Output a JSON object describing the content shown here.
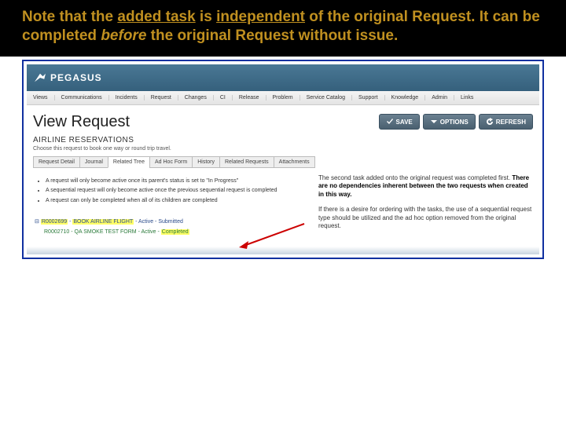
{
  "note": {
    "pre": "Note that the ",
    "added_task": "added task",
    "mid1": " is ",
    "independent": "independent",
    "mid2": " of the original Request. It can be completed ",
    "before": "before",
    "post": " the original Request without issue."
  },
  "app": {
    "brand": "PEGASUS",
    "menu": [
      "Views",
      "Communications",
      "Incidents",
      "Request",
      "Changes",
      "CI",
      "Release",
      "Problem",
      "Service Catalog",
      "Support",
      "Knowledge",
      "Admin",
      "Links"
    ]
  },
  "page": {
    "title": "View Request",
    "buttons": {
      "save": "SAVE",
      "options": "OPTIONS",
      "refresh": "REFRESH"
    },
    "section": {
      "title": "AIRLINE RESERVATIONS",
      "subtitle": "Choose this request to book one way or round trip travel."
    },
    "tabs": [
      "Request Detail",
      "Journal",
      "Related Tree",
      "Ad Hoc Form",
      "History",
      "Related Requests",
      "Attachments"
    ],
    "activeTabIndex": 2
  },
  "bullets": [
    "A request will only become active once its parent's status is set to \"In Progress\"",
    "A sequential request will only become active once the previous sequential request is completed",
    "A request can only be completed when all of its children are completed"
  ],
  "tasks": {
    "row1": {
      "prefix": "⊟ ",
      "id": "R0002699",
      "sep": " - ",
      "name": "BOOK AIRLINE FLIGHT",
      "status1": " - Active - ",
      "status2": "Submitted"
    },
    "row2": {
      "id": "R0002710",
      "sep": " - ",
      "name": "QA SMOKE TEST FORM",
      "status1": " - Active - ",
      "status2": "Completed"
    }
  },
  "side": {
    "p1a": "The second task added onto the original request was completed first. ",
    "p1b": "There are no dependencies inherent between the two requests when created in this way.",
    "p2": "If there is a desire for ordering with the tasks, the use of a sequential request type should be utilized and the ad hoc option removed from the original request."
  }
}
